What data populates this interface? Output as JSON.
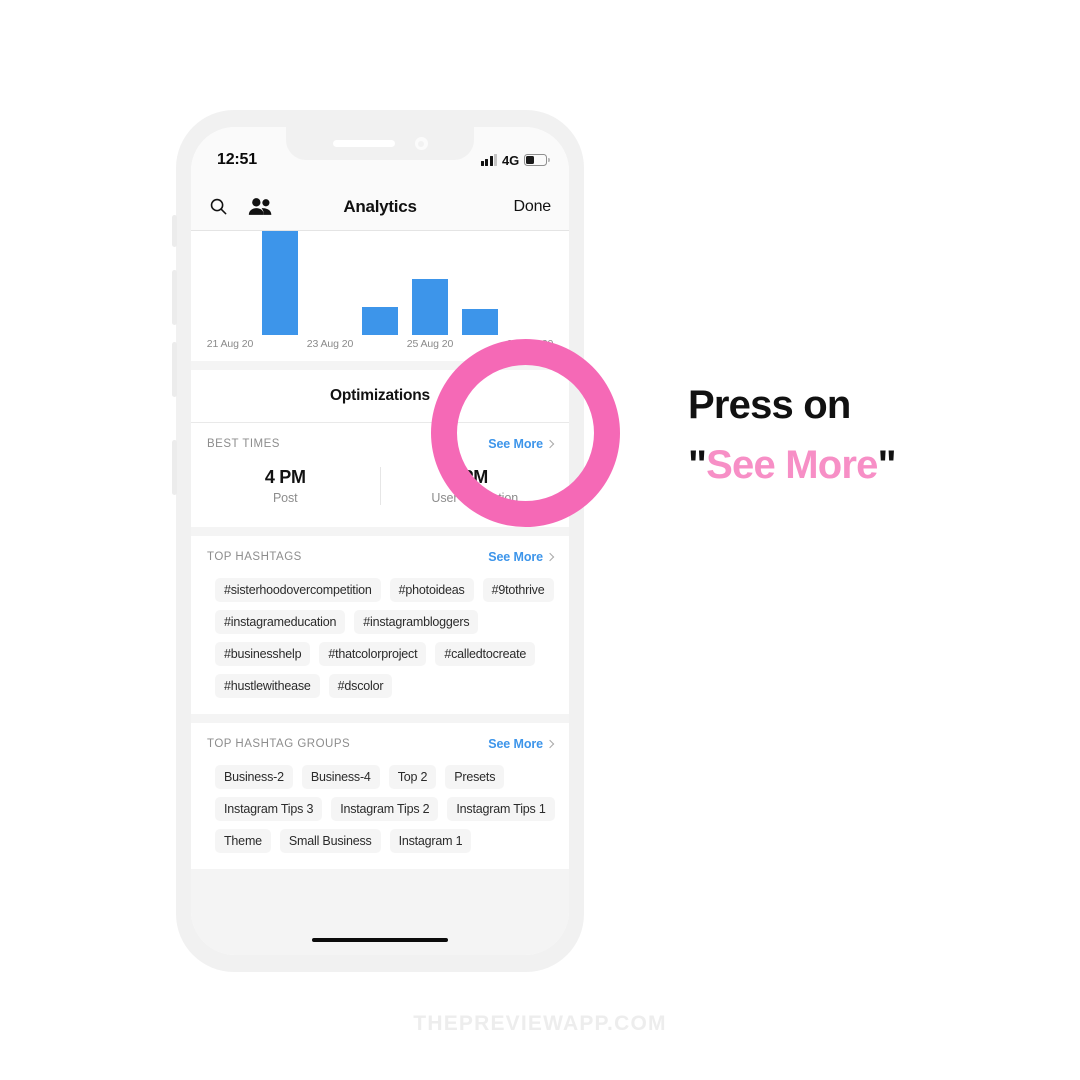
{
  "status_bar": {
    "time": "12:51",
    "network": "4G",
    "signal_icon": "signal-bars-icon",
    "battery_icon": "battery-icon",
    "battery_level_pct": 40
  },
  "nav_bar": {
    "search_icon": "search-icon",
    "people_icon": "people-icon",
    "title": "Analytics",
    "done_label": "Done"
  },
  "chart_data": {
    "type": "bar",
    "title": "",
    "xlabel": "",
    "ylabel": "",
    "grid": false,
    "legend": null,
    "bar_color": "#3d95ea",
    "categories": [
      "21 Aug 20",
      "",
      "23 Aug 20",
      "",
      "25 Aug 20",
      "",
      "27 Aug 20"
    ],
    "tick_labels": [
      "21 Aug 20",
      "23 Aug 20",
      "25 Aug 20",
      "27 Aug 20"
    ],
    "values": [
      0,
      104,
      0,
      28,
      56,
      26,
      0
    ],
    "note": "first bar is clipped at the top of the scrolled viewport; heights are pixel heights in the visible plot area"
  },
  "optimizations": {
    "header": "Optimizations",
    "best_times": {
      "section_title": "BEST TIMES",
      "see_more_label": "See More",
      "chevron_icon": "chevron-right-icon",
      "columns": [
        {
          "value": "4 PM",
          "label": "Post"
        },
        {
          "value": "PM",
          "label": "User Interaction"
        }
      ]
    }
  },
  "top_hashtags": {
    "section_title": "TOP HASHTAGS",
    "see_more_label": "See More",
    "chevron_icon": "chevron-right-icon",
    "items": [
      "#sisterhoodovercompetition",
      "#photoideas",
      "#9tothrive",
      "#instagrameducation",
      "#instagrambloggers",
      "#businesshelp",
      "#thatcolorproject",
      "#calledtocreate",
      "#hustlewithease",
      "#dscolor"
    ]
  },
  "top_hashtag_groups": {
    "section_title": "TOP HASHTAG GROUPS",
    "see_more_label": "See More",
    "chevron_icon": "chevron-right-icon",
    "items": [
      "Business-2",
      "Business-4",
      "Top 2",
      "Presets",
      "Instagram Tips 3",
      "Instagram Tips 2",
      "Instagram Tips 1",
      "Theme",
      "Small Business",
      "Instagram 1"
    ]
  },
  "annotation": {
    "line1": "Press on",
    "quote_open": "\"",
    "highlight": "See More",
    "quote_close": "\"",
    "highlight_color": "#f78fc6",
    "ring_color": "#f569b6"
  },
  "watermark": {
    "text": "THEPREVIEWAPP.COM"
  }
}
